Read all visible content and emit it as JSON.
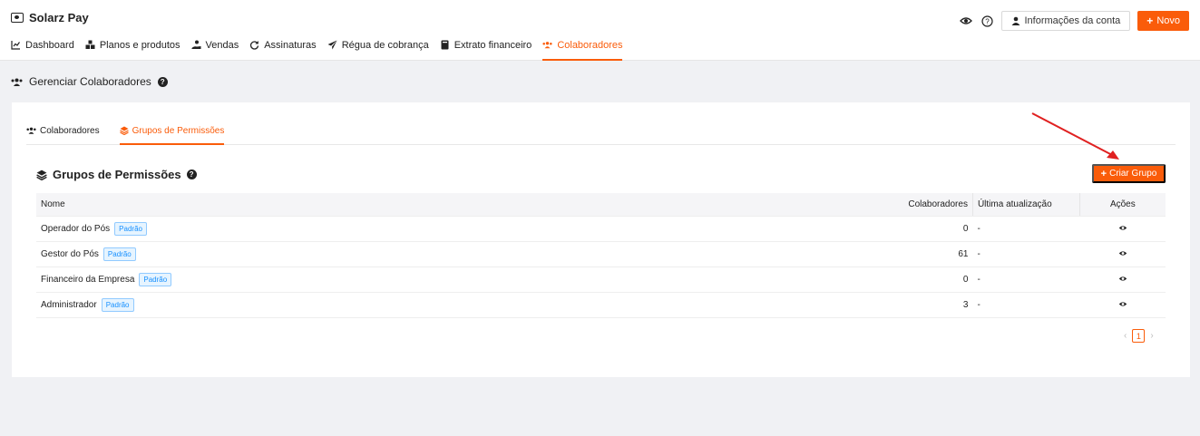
{
  "app": {
    "title": "Solarz Pay"
  },
  "top_actions": {
    "account_label": "Informações da conta",
    "new_label": "Novo"
  },
  "nav": [
    {
      "label": "Dashboard",
      "icon": "chart-line-icon",
      "active": false
    },
    {
      "label": "Planos e produtos",
      "icon": "boxes-icon",
      "active": false
    },
    {
      "label": "Vendas",
      "icon": "hand-coin-icon",
      "active": false
    },
    {
      "label": "Assinaturas",
      "icon": "refresh-icon",
      "active": false
    },
    {
      "label": "Régua de cobrança",
      "icon": "paper-plane-icon",
      "active": false
    },
    {
      "label": "Extrato financeiro",
      "icon": "book-icon",
      "active": false
    },
    {
      "label": "Colaboradores",
      "icon": "users-icon",
      "active": true
    }
  ],
  "page": {
    "heading": "Gerenciar Colaboradores"
  },
  "tabs": [
    {
      "label": "Colaboradores",
      "active": false
    },
    {
      "label": "Grupos de Permissões",
      "active": true
    }
  ],
  "section": {
    "title": "Grupos de Permissões",
    "create_label": "Criar Grupo"
  },
  "table": {
    "columns": [
      "Nome",
      "Colaboradores",
      "Última atualização",
      "Ações"
    ],
    "rows": [
      {
        "name": "Operador do Pós",
        "badge": "Padrão",
        "count": "0",
        "updated": "-"
      },
      {
        "name": "Gestor do Pós",
        "badge": "Padrão",
        "count": "61",
        "updated": "-"
      },
      {
        "name": "Financeiro da Empresa",
        "badge": "Padrão",
        "count": "0",
        "updated": "-"
      },
      {
        "name": "Administrador",
        "badge": "Padrão",
        "count": "3",
        "updated": "-"
      }
    ]
  },
  "pagination": {
    "current": "1"
  },
  "colors": {
    "accent": "#fa5c0a",
    "annotation": "#e02020",
    "badge": "#1890ff"
  }
}
